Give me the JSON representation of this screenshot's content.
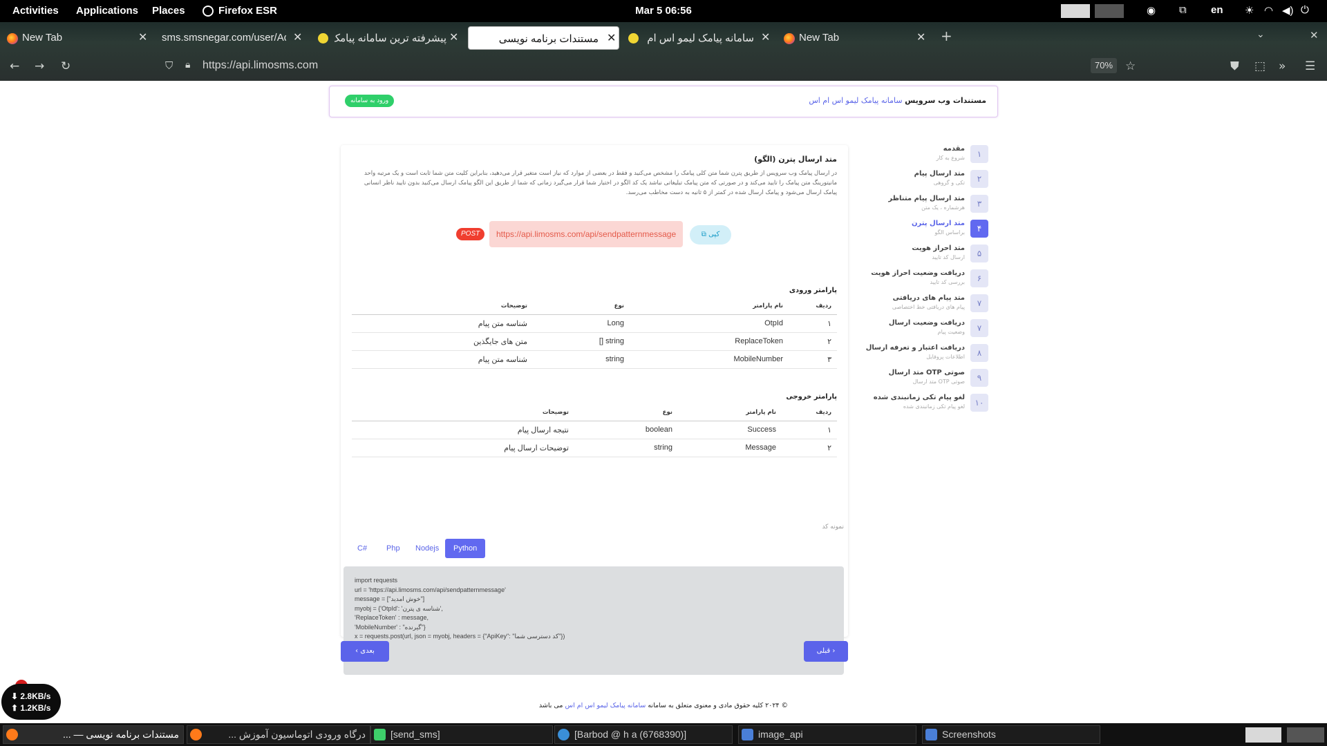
{
  "topbar": {
    "activities": "Activities",
    "applications": "Applications",
    "places": "Places",
    "firefox": "Firefox ESR",
    "clock": "Mar 5  06:56",
    "lang": "en"
  },
  "tabs": [
    {
      "title": "New Tab"
    },
    {
      "title": "sms.smsnegar.com/user/Adı"
    },
    {
      "title": "پیشرفته ترین سامانه پیامک"
    },
    {
      "title": "مستندات برنامه نویسی"
    },
    {
      "title": "سامانه پیامک لیمو اس ام"
    },
    {
      "title": "New Tab"
    }
  ],
  "navbar": {
    "url": "https://api.limosms.com",
    "zoom": "70%"
  },
  "header": {
    "title_bold": "مستندات وب سرویس",
    "title_link": "سامانه پیامک لیمو اس ام اس",
    "login": "ورود به سامانه"
  },
  "steps": [
    {
      "num": "۱",
      "title": "مقدمه",
      "sub": "شروع به کار"
    },
    {
      "num": "۲",
      "title": "متد ارسال پیام",
      "sub": "تکی و گروهی"
    },
    {
      "num": "۳",
      "title": "متد ارسال پیام متناظر",
      "sub": "هرشماره ، یک متن"
    },
    {
      "num": "۴",
      "title": "متد ارسال پترن",
      "sub": "براساس الگو"
    },
    {
      "num": "۵",
      "title": "متد احراز هویت",
      "sub": "ارسال کد تایید"
    },
    {
      "num": "۶",
      "title": "دریافت وضعیت احراز هویت",
      "sub": "بررسی کد تایید"
    },
    {
      "num": "۷",
      "title": "متد پیام های دریافتی",
      "sub": "پیام های دریافتی خط اختصاصی"
    },
    {
      "num": "۷",
      "title": "دریافت وضعیت ارسال",
      "sub": "وضعیت پیام"
    },
    {
      "num": "۸",
      "title": "دریافت اعتبار و تعرفه ارسال",
      "sub": "اطلاعات پروفایل"
    },
    {
      "num": "۹",
      "title": "متد ارسال OTP صوتی",
      "sub": "متد ارسال OTP صوتی"
    },
    {
      "num": "۱۰",
      "title": "لغو پیام تکی زمانبندی شده",
      "sub": "لغو پیام تکی زمانبندی شده"
    }
  ],
  "main": {
    "title": "متد ارسال پترن (الگو)",
    "desc1": "در ارسال پیامک وب سرویس از طریق پترن شما متن کلی پیامک را مشخص می‌کنید و فقط در بعضی از موارد که نیاز است متغیر قرار می‌دهید، بنابراین کلیت متن شما ثابت است و یک مرتبه واحد",
    "desc2": "مانیتورینگ متن پیامک را تایید می‌کند و در صورتی که متن پیامک تبلیغاتی نباشد یک کد الگو در اختیار شما قرار می‌گیرد زمانی که شما از طریق این الگو پیامک ارسال می‌کنید بدون تایید ناظر انسانی",
    "desc3": "پیامک ارسال می‌شود و پیامک ارسال شده در کمتر از ۵ ثانیه به دست مخاطب می‌رسد.",
    "endpoint": "https://api.limosms.com/api/sendpatternmessage",
    "method": "POST",
    "copy": "کپی",
    "input_title": "پارامتر ورودی",
    "output_title": "پارامتر خروجی",
    "sample_label": "نمونه کد",
    "input_headers": [
      "ردیف",
      "نام پارامتر",
      "نوع",
      "توضیحات"
    ],
    "input_rows": [
      [
        "۱",
        "OtpId",
        "Long",
        "شناسه متن پیام"
      ],
      [
        "۲",
        "ReplaceToken",
        "string []",
        "متن های جایگذین"
      ],
      [
        "۳",
        "MobileNumber",
        "string",
        "شناسه متن پیام"
      ]
    ],
    "output_headers": [
      "ردیف",
      "نام پارامتر",
      "نوع",
      "توضیحات"
    ],
    "output_rows": [
      [
        "۱",
        "Success",
        "boolean",
        "نتیجه ارسال پیام"
      ],
      [
        "۲",
        "Message",
        "string",
        "توضیحات ارسال پیام"
      ]
    ],
    "code_tabs": [
      "C#",
      "Php",
      "Nodejs",
      "Python"
    ],
    "active_code_tab": "Python",
    "code": "import requests\nurl = 'https://api.limosms.com/api/sendpatternmessage'\nmessage = [\"خوش امدید\"]\nmyobj = {'OtpId': 'شناسه ی پترن',\n'ReplaceToken' : message,\n'MobileNumber' : \"گیرنده\"}\nx = requests.post(url, json = myobj, headers = {\"ApiKey\": \"کد دسترسی شما\"})\nprint(x.text)",
    "next": "بعدی",
    "prev": "قبلی"
  },
  "footer": {
    "pre": "© ۲۰۲۴ کلیه حقوق مادی و معنوی متعلق به سامانه",
    "link": "سامانه پیامک لیمو اس ام اس",
    "post": "می باشد"
  },
  "net": {
    "down": "⬇ 2.8KB/s",
    "up": "⬆ 1.2KB/s"
  },
  "taskbar": [
    {
      "label": "مستندات برنامه نویسی — ..."
    },
    {
      "label": "درگاه ورودی اتوماسیون آموزش ..."
    },
    {
      "label": "[send_sms]"
    },
    {
      "label": "[Barbod @ h a (6768390)]"
    },
    {
      "label": "image_api"
    },
    {
      "label": "Screenshots"
    }
  ]
}
